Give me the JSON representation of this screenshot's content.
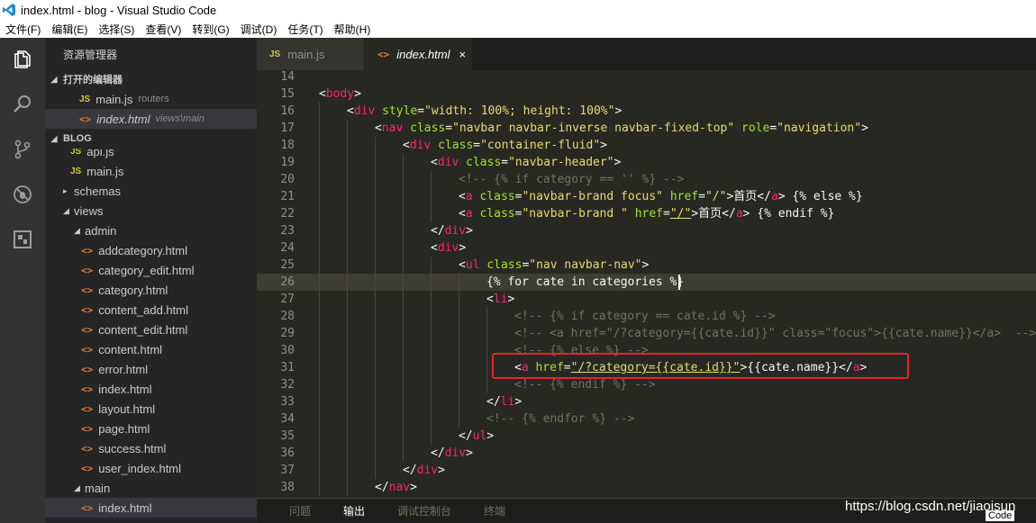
{
  "window": {
    "title": "index.html - blog - Visual Studio Code"
  },
  "menubar": [
    "文件(F)",
    "编辑(E)",
    "选择(S)",
    "查看(V)",
    "转到(G)",
    "调试(D)",
    "任务(T)",
    "帮助(H)"
  ],
  "activity_bar": [
    "files-icon",
    "search-icon",
    "source-control-icon",
    "debug-icon",
    "extensions-icon"
  ],
  "sidebar": {
    "title": "资源管理器",
    "open_editors_header": "打开的编辑器",
    "open_editors": [
      {
        "name": "main.js",
        "desc": "routers",
        "type": "js"
      },
      {
        "name": "index.html",
        "desc": "views\\main",
        "type": "html",
        "selected": true
      }
    ],
    "project_header": "BLOG",
    "tree": [
      {
        "name": "api.js",
        "type": "js",
        "depth": 1
      },
      {
        "name": "main.js",
        "type": "js",
        "depth": 1
      },
      {
        "name": "schemas",
        "type": "folder",
        "depth": 1,
        "open": false
      },
      {
        "name": "views",
        "type": "folder",
        "depth": 1,
        "open": true
      },
      {
        "name": "admin",
        "type": "folder",
        "depth": 2,
        "open": true
      },
      {
        "name": "addcategory.html",
        "type": "html",
        "depth": 3
      },
      {
        "name": "category_edit.html",
        "type": "html",
        "depth": 3
      },
      {
        "name": "category.html",
        "type": "html",
        "depth": 3
      },
      {
        "name": "content_add.html",
        "type": "html",
        "depth": 3
      },
      {
        "name": "content_edit.html",
        "type": "html",
        "depth": 3
      },
      {
        "name": "content.html",
        "type": "html",
        "depth": 3
      },
      {
        "name": "error.html",
        "type": "html",
        "depth": 3
      },
      {
        "name": "index.html",
        "type": "html",
        "depth": 3
      },
      {
        "name": "layout.html",
        "type": "html",
        "depth": 3
      },
      {
        "name": "page.html",
        "type": "html",
        "depth": 3
      },
      {
        "name": "success.html",
        "type": "html",
        "depth": 3
      },
      {
        "name": "user_index.html",
        "type": "html",
        "depth": 3
      },
      {
        "name": "main",
        "type": "folder",
        "depth": 2,
        "open": true
      },
      {
        "name": "index.html",
        "type": "html",
        "depth": 3,
        "selected": true
      }
    ]
  },
  "tabs": [
    {
      "label": "main.js",
      "type": "js",
      "active": false,
      "italic": false
    },
    {
      "label": "index.html",
      "type": "html",
      "active": true,
      "italic": true,
      "close": "×"
    }
  ],
  "editor": {
    "current_line": 26,
    "lines": [
      {
        "n": "14",
        "indent": 0,
        "tokens": []
      },
      {
        "n": "15",
        "indent": 0,
        "tokens": [
          [
            "pun",
            "<"
          ],
          [
            "tag",
            "body"
          ],
          [
            "pun",
            ">"
          ]
        ]
      },
      {
        "n": "16",
        "indent": 1,
        "tokens": [
          [
            "pun",
            "<"
          ],
          [
            "tag",
            "div"
          ],
          [
            "txt",
            " "
          ],
          [
            "attr",
            "style"
          ],
          [
            "pun",
            "="
          ],
          [
            "str",
            "\"width: 100%; height: 100%\""
          ],
          [
            "pun",
            ">"
          ]
        ]
      },
      {
        "n": "17",
        "indent": 2,
        "tokens": [
          [
            "pun",
            "<"
          ],
          [
            "tag",
            "nav"
          ],
          [
            "txt",
            " "
          ],
          [
            "attr",
            "class"
          ],
          [
            "pun",
            "="
          ],
          [
            "str",
            "\"navbar navbar-inverse navbar-fixed-top\""
          ],
          [
            "txt",
            " "
          ],
          [
            "attr",
            "role"
          ],
          [
            "pun",
            "="
          ],
          [
            "str",
            "\"navigation\""
          ],
          [
            "pun",
            ">"
          ]
        ]
      },
      {
        "n": "18",
        "indent": 3,
        "tokens": [
          [
            "pun",
            "<"
          ],
          [
            "tag",
            "div"
          ],
          [
            "txt",
            " "
          ],
          [
            "attr",
            "class"
          ],
          [
            "pun",
            "="
          ],
          [
            "str",
            "\"container-fluid\""
          ],
          [
            "pun",
            ">"
          ]
        ]
      },
      {
        "n": "19",
        "indent": 4,
        "tokens": [
          [
            "pun",
            "<"
          ],
          [
            "tag",
            "div"
          ],
          [
            "txt",
            " "
          ],
          [
            "attr",
            "class"
          ],
          [
            "pun",
            "="
          ],
          [
            "str",
            "\"navbar-header\""
          ],
          [
            "pun",
            ">"
          ]
        ]
      },
      {
        "n": "20",
        "indent": 5,
        "tokens": [
          [
            "com",
            "<!-- {% if category == '' %} -->"
          ]
        ]
      },
      {
        "n": "21",
        "indent": 5,
        "tokens": [
          [
            "pun",
            "<"
          ],
          [
            "tag",
            "a"
          ],
          [
            "txt",
            " "
          ],
          [
            "attr",
            "class"
          ],
          [
            "pun",
            "="
          ],
          [
            "str",
            "\"navbar-brand focus\""
          ],
          [
            "txt",
            " "
          ],
          [
            "attr",
            "href"
          ],
          [
            "pun",
            "="
          ],
          [
            "str",
            "\"/\""
          ],
          [
            "pun",
            ">"
          ],
          [
            "txt",
            "首页"
          ],
          [
            "pun",
            "</"
          ],
          [
            "tag",
            "a"
          ],
          [
            "pun",
            ">"
          ],
          [
            "txt",
            " {% else %}"
          ]
        ]
      },
      {
        "n": "22",
        "indent": 5,
        "tokens": [
          [
            "pun",
            "<"
          ],
          [
            "tag",
            "a"
          ],
          [
            "txt",
            " "
          ],
          [
            "attr",
            "class"
          ],
          [
            "pun",
            "="
          ],
          [
            "str",
            "\"navbar-brand \""
          ],
          [
            "txt",
            " "
          ],
          [
            "attr",
            "href"
          ],
          [
            "pun",
            "="
          ],
          [
            "strul",
            "\"/\""
          ],
          [
            "pun",
            ">"
          ],
          [
            "txt",
            "首页"
          ],
          [
            "pun",
            "</"
          ],
          [
            "tag",
            "a"
          ],
          [
            "pun",
            ">"
          ],
          [
            "txt",
            " {% endif %}"
          ]
        ]
      },
      {
        "n": "23",
        "indent": 4,
        "tokens": [
          [
            "pun",
            "</"
          ],
          [
            "tag",
            "div"
          ],
          [
            "pun",
            ">"
          ]
        ]
      },
      {
        "n": "24",
        "indent": 4,
        "tokens": [
          [
            "pun",
            "<"
          ],
          [
            "tag",
            "div"
          ],
          [
            "pun",
            ">"
          ]
        ]
      },
      {
        "n": "25",
        "indent": 5,
        "tokens": [
          [
            "pun",
            "<"
          ],
          [
            "tag",
            "ul"
          ],
          [
            "txt",
            " "
          ],
          [
            "attr",
            "class"
          ],
          [
            "pun",
            "="
          ],
          [
            "str",
            "\"nav navbar-nav\""
          ],
          [
            "pun",
            ">"
          ]
        ]
      },
      {
        "n": "26",
        "indent": 6,
        "tokens": [
          [
            "txt",
            "{% for cate in categories %}"
          ]
        ]
      },
      {
        "n": "27",
        "indent": 6,
        "tokens": [
          [
            "pun",
            "<"
          ],
          [
            "tag",
            "li"
          ],
          [
            "pun",
            ">"
          ]
        ]
      },
      {
        "n": "28",
        "indent": 7,
        "tokens": [
          [
            "com",
            "<!-- {% if category == cate.id %} -->"
          ]
        ]
      },
      {
        "n": "29",
        "indent": 7,
        "tokens": [
          [
            "com",
            "<!-- <a href=\"/?category={{cate.id}}\" class=\"focus\">{{cate.name}}</a>  -->"
          ]
        ]
      },
      {
        "n": "30",
        "indent": 7,
        "tokens": [
          [
            "com",
            "<!-- {% else %} -->"
          ]
        ]
      },
      {
        "n": "31",
        "indent": 7,
        "tokens": [
          [
            "pun",
            "<"
          ],
          [
            "tag",
            "a"
          ],
          [
            "txt",
            " "
          ],
          [
            "attr",
            "href"
          ],
          [
            "pun",
            "="
          ],
          [
            "strul",
            "\"/?category={{cate.id}}\""
          ],
          [
            "pun",
            ">"
          ],
          [
            "txt",
            "{{cate.name}}"
          ],
          [
            "pun",
            "</"
          ],
          [
            "tag",
            "a"
          ],
          [
            "pun",
            ">"
          ]
        ]
      },
      {
        "n": "32",
        "indent": 7,
        "tokens": [
          [
            "com",
            "<!-- {% endif %} -->"
          ]
        ]
      },
      {
        "n": "33",
        "indent": 6,
        "tokens": [
          [
            "pun",
            "</"
          ],
          [
            "tag",
            "li"
          ],
          [
            "pun",
            ">"
          ]
        ]
      },
      {
        "n": "34",
        "indent": 6,
        "tokens": [
          [
            "com",
            "<!-- {% endfor %} -->"
          ]
        ]
      },
      {
        "n": "35",
        "indent": 5,
        "tokens": [
          [
            "pun",
            "</"
          ],
          [
            "tag",
            "ul"
          ],
          [
            "pun",
            ">"
          ]
        ]
      },
      {
        "n": "36",
        "indent": 4,
        "tokens": [
          [
            "pun",
            "</"
          ],
          [
            "tag",
            "div"
          ],
          [
            "pun",
            ">"
          ]
        ]
      },
      {
        "n": "37",
        "indent": 3,
        "tokens": [
          [
            "pun",
            "</"
          ],
          [
            "tag",
            "div"
          ],
          [
            "pun",
            ">"
          ]
        ]
      },
      {
        "n": "38",
        "indent": 2,
        "tokens": [
          [
            "pun",
            "</"
          ],
          [
            "tag",
            "nav"
          ],
          [
            "pun",
            ">"
          ]
        ]
      }
    ]
  },
  "panel_tabs": [
    {
      "label": "问题",
      "active": false
    },
    {
      "label": "输出",
      "active": true
    },
    {
      "label": "调试控制台",
      "active": false
    },
    {
      "label": "终端",
      "active": false
    }
  ],
  "watermark": "https://blog.csdn.net/jiaojsun",
  "corner_label": "Code",
  "colors": {
    "editor_bg": "#272822",
    "tag": "#f92672",
    "attr": "#a6e22e",
    "string": "#e6db74",
    "comment": "#75715e",
    "highlight_box": "#e8242a"
  }
}
